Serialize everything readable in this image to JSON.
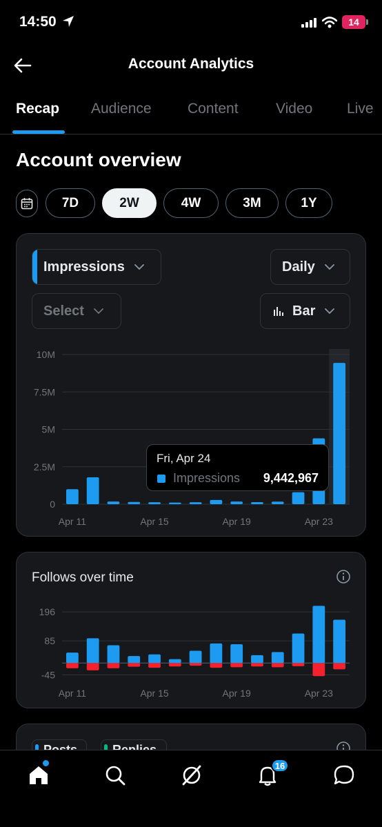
{
  "status_bar": {
    "time": "14:50",
    "battery": "14"
  },
  "header": {
    "title": "Account Analytics"
  },
  "tabs": [
    {
      "label": "Recap",
      "active": true
    },
    {
      "label": "Audience",
      "active": false
    },
    {
      "label": "Content",
      "active": false
    },
    {
      "label": "Video",
      "active": false
    },
    {
      "label": "Live",
      "active": false
    }
  ],
  "overview": {
    "title": "Account overview",
    "ranges": [
      "7D",
      "2W",
      "4W",
      "3M",
      "1Y"
    ],
    "selected_range": "2W"
  },
  "impressions_card": {
    "metric_select": "Impressions",
    "interval_select": "Daily",
    "compare_select": "Select",
    "chart_type_select": "Bar",
    "tooltip": {
      "date": "Fri, Apr 24",
      "metric": "Impressions",
      "value": "9,442,967"
    }
  },
  "follows_card": {
    "title": "Follows over time"
  },
  "posts_card": {
    "chips": [
      "Posts",
      "Replies"
    ]
  },
  "nav": {
    "notifications_badge": "16"
  },
  "colors": {
    "accent": "#1d9bf0",
    "negative": "#f4212e",
    "background": "#000000",
    "card": "#16181c"
  },
  "chart_data": [
    {
      "type": "bar",
      "categories": [
        "Apr 11",
        "Apr 12",
        "Apr 13",
        "Apr 14",
        "Apr 15",
        "Apr 16",
        "Apr 17",
        "Apr 18",
        "Apr 19",
        "Apr 20",
        "Apr 21",
        "Apr 22",
        "Apr 23",
        "Apr 24"
      ],
      "tick_labels": [
        "Apr 11",
        "Apr 15",
        "Apr 19",
        "Apr 23"
      ],
      "y_tick_labels": [
        "10M",
        "7.5M",
        "5M",
        "2.5M",
        "0"
      ],
      "series": [
        {
          "name": "Impressions",
          "values": [
            1000000,
            1800000,
            180000,
            150000,
            130000,
            110000,
            130000,
            280000,
            180000,
            140000,
            170000,
            800000,
            4400000,
            9442967
          ]
        }
      ],
      "ylim": [
        0,
        10000000
      ],
      "highlighted_index": 13,
      "grid": true
    },
    {
      "type": "bar",
      "categories": [
        "Apr 11",
        "Apr 12",
        "Apr 13",
        "Apr 14",
        "Apr 15",
        "Apr 16",
        "Apr 17",
        "Apr 18",
        "Apr 19",
        "Apr 20",
        "Apr 21",
        "Apr 22",
        "Apr 23",
        "Apr 24"
      ],
      "tick_labels": [
        "Apr 11",
        "Apr 15",
        "Apr 19",
        "Apr 23"
      ],
      "y_tick_labels": [
        "196",
        "85",
        "-45"
      ],
      "title": "Follows over time",
      "series": [
        {
          "values": [
            40,
            95,
            68,
            27,
            33,
            15,
            47,
            75,
            72,
            30,
            42,
            113,
            219,
            166
          ]
        },
        {
          "values": [
            -20,
            -28,
            -20,
            -14,
            -18,
            -13,
            -10,
            -18,
            -16,
            -13,
            -16,
            -12,
            -50,
            -24
          ]
        }
      ],
      "ylim": [
        -60,
        220
      ],
      "grid": true
    }
  ]
}
